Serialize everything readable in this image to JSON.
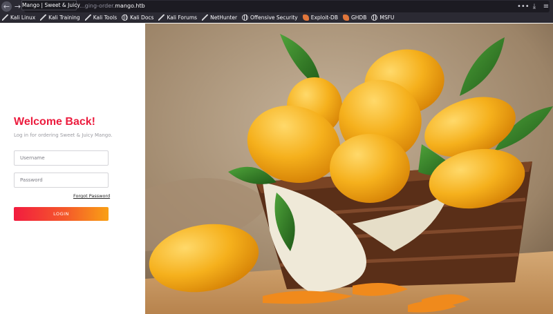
{
  "browser": {
    "tab_tooltip": "Mango | Sweet & Juicy",
    "url_prefix": "...ging-order.",
    "url_host": "mango.htb",
    "menu_dots": "•••",
    "download_glyph": "⤓",
    "hamburger_glyph": "≡",
    "back_glyph": "←",
    "forward_glyph": "→"
  },
  "bookmarks": [
    {
      "label": "Kali Linux",
      "icon": "kali-dragon-icon"
    },
    {
      "label": "Kali Training",
      "icon": "kali-dragon-icon"
    },
    {
      "label": "Kali Tools",
      "icon": "kali-dragon-icon"
    },
    {
      "label": "Kali Docs",
      "icon": "globe-icon"
    },
    {
      "label": "Kali Forums",
      "icon": "kali-dragon-icon"
    },
    {
      "label": "NetHunter",
      "icon": "kali-dragon-icon"
    },
    {
      "label": "Offensive Security",
      "icon": "globe-icon"
    },
    {
      "label": "Exploit-DB",
      "icon": "exploit-db-icon"
    },
    {
      "label": "GHDB",
      "icon": "exploit-db-icon"
    },
    {
      "label": "MSFU",
      "icon": "globe-icon"
    }
  ],
  "login": {
    "title": "Welcome Back!",
    "subtitle": "Log in for ordering Sweet & Juicy Mango.",
    "username_placeholder": "Username",
    "password_placeholder": "Password",
    "forgot_label": "Forgot Password",
    "login_label": "LOGIN",
    "accent_color": "#ec1c3e",
    "button_gradient": [
      "#f21c3f",
      "#f9a015"
    ]
  },
  "hero": {
    "subject": "basket of ripe mangoes on a cloth"
  }
}
